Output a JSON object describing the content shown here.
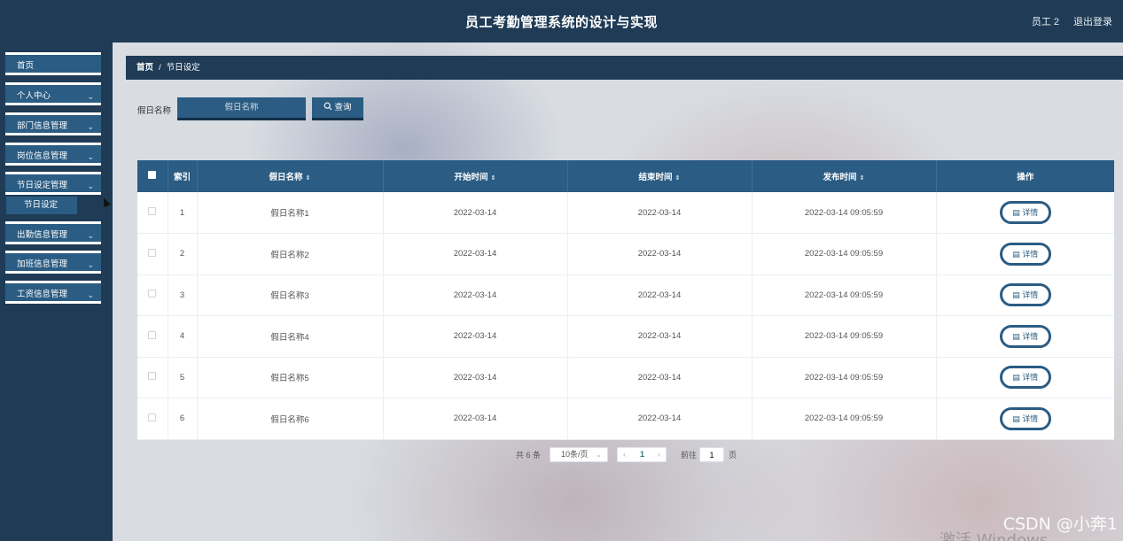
{
  "header": {
    "title": "员工考勤管理系统的设计与实现",
    "user": "员工 2",
    "logout": "退出登录"
  },
  "sidebar": {
    "items": [
      {
        "label": "首页",
        "chevron": ""
      },
      {
        "label": "个人中心",
        "chevron": "⌄"
      },
      {
        "label": "部门信息管理",
        "chevron": "⌄"
      },
      {
        "label": "岗位信息管理",
        "chevron": "⌄"
      },
      {
        "label": "节日设定管理",
        "chevron": "⌄"
      },
      {
        "label": "出勤信息管理",
        "chevron": "⌄"
      },
      {
        "label": "加班信息管理",
        "chevron": "⌄"
      },
      {
        "label": "工资信息管理",
        "chevron": "⌄"
      }
    ],
    "sub_item": "节日设定"
  },
  "breadcrumb": {
    "home": "首页",
    "separator": "/",
    "current": "节日设定"
  },
  "search": {
    "label": "假日名称",
    "placeholder": "假日名称",
    "button": "查询",
    "button_icon": "search-icon"
  },
  "table": {
    "headers": [
      "索引",
      "假日名称",
      "开始时间",
      "结束时间",
      "发布时间",
      "操作"
    ],
    "sort_icon": "⇕",
    "detail_label": "详情",
    "rows": [
      {
        "index": "1",
        "name": "假日名称1",
        "start": "2022-03-14",
        "end": "2022-03-14",
        "published": "2022-03-14 09:05:59"
      },
      {
        "index": "2",
        "name": "假日名称2",
        "start": "2022-03-14",
        "end": "2022-03-14",
        "published": "2022-03-14 09:05:59"
      },
      {
        "index": "3",
        "name": "假日名称3",
        "start": "2022-03-14",
        "end": "2022-03-14",
        "published": "2022-03-14 09:05:59"
      },
      {
        "index": "4",
        "name": "假日名称4",
        "start": "2022-03-14",
        "end": "2022-03-14",
        "published": "2022-03-14 09:05:59"
      },
      {
        "index": "5",
        "name": "假日名称5",
        "start": "2022-03-14",
        "end": "2022-03-14",
        "published": "2022-03-14 09:05:59"
      },
      {
        "index": "6",
        "name": "假日名称6",
        "start": "2022-03-14",
        "end": "2022-03-14",
        "published": "2022-03-14 09:05:59"
      }
    ]
  },
  "pagination": {
    "total": "共 6 条",
    "page_size": "10条/页",
    "current_page": "1",
    "goto_label": "前往",
    "goto_value": "1",
    "page_unit": "页"
  },
  "watermark": "CSDN @小奔1",
  "activate_text": "激活 Windows",
  "colors": {
    "primary": "#2b5c83",
    "header": "#1f3b55"
  }
}
